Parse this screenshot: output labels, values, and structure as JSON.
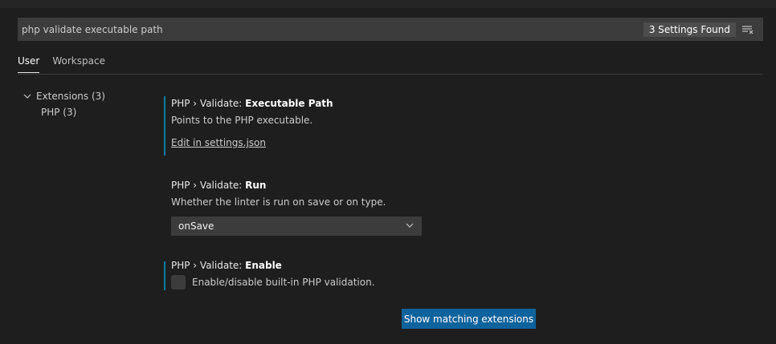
{
  "search": {
    "value": "php validate executable path",
    "count_label": "3 Settings Found"
  },
  "tabs": [
    {
      "label": "User",
      "active": true
    },
    {
      "label": "Workspace",
      "active": false
    }
  ],
  "toc": {
    "group_label": "Extensions (3)",
    "child_label": "PHP (3)"
  },
  "settings": {
    "executable_path": {
      "category": "PHP › Validate: ",
      "name": "Executable Path",
      "description": "Points to the PHP executable.",
      "link": "Edit in settings.json"
    },
    "run": {
      "category": "PHP › Validate: ",
      "name": "Run",
      "description": "Whether the linter is run on save or on type.",
      "selected": "onSave"
    },
    "enable": {
      "category": "PHP › Validate: ",
      "name": "Enable",
      "description": "Enable/disable built-in PHP validation.",
      "checked": false
    }
  },
  "footer_button": "Show matching extensions",
  "icons": {
    "filter": "filter-list-icon",
    "chevron_group": "chevron-down-icon",
    "chevron_dropdown": "chevron-down-icon"
  },
  "colors": {
    "background": "#1e1e1e",
    "input": "#3c3c3c",
    "modified_indicator": "#0c7d9d",
    "button": "#0e639c"
  }
}
